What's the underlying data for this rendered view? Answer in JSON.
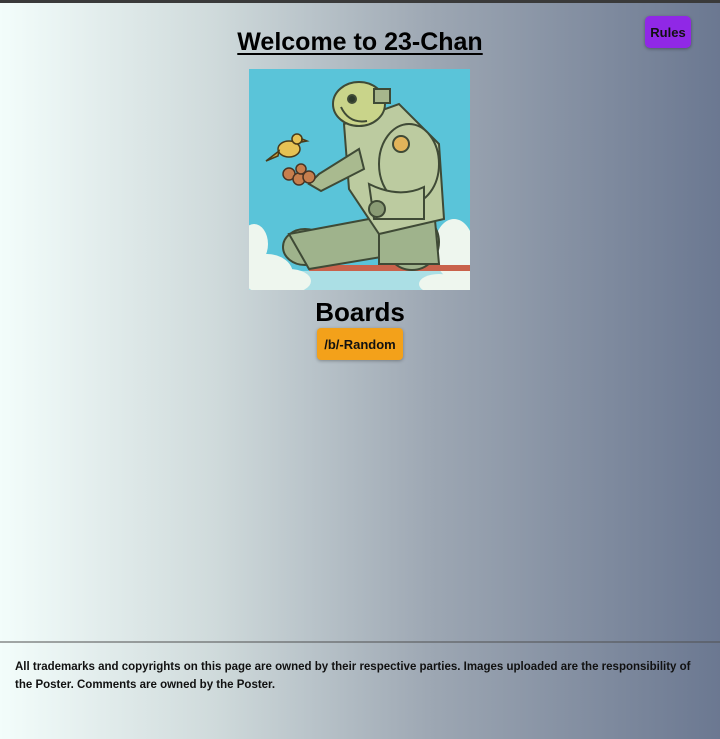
{
  "header": {
    "title": "Welcome to 23-Chan",
    "rules_label": "Rules"
  },
  "hero": {
    "image": "robot-with-bird-illustration"
  },
  "boards": {
    "heading": "Boards",
    "items": [
      {
        "label": "/b/-Random"
      }
    ]
  },
  "footer": {
    "text": "All trademarks and copyrights on this page are owned by their respective parties. Images uploaded are the responsibility of the Poster. Comments are owned by the Poster."
  },
  "colors": {
    "rules_button": "#9028e6",
    "board_button": "#f3a11a",
    "sky": "#58c3d8",
    "robot": "#b7c9a1"
  }
}
